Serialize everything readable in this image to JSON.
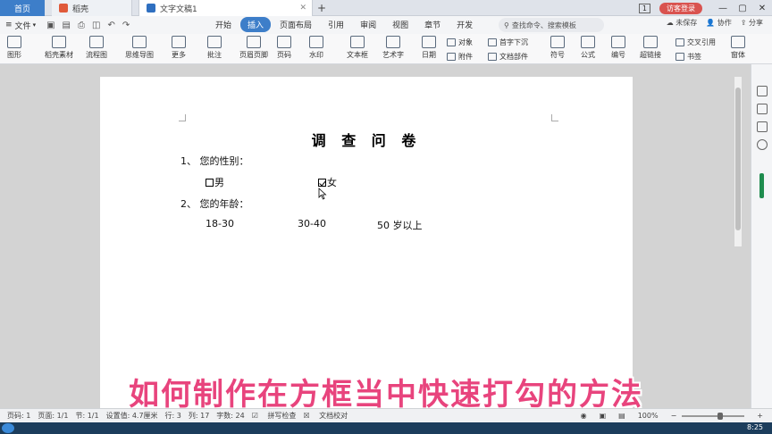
{
  "tabs": {
    "home": "首页",
    "daoke": "稻壳",
    "doc": "文字文稿1",
    "plus": "+"
  },
  "titlebar": {
    "page_badge": "1",
    "login": "访客登录",
    "min": "—",
    "max": "▢",
    "close": "✕"
  },
  "menubar": {
    "file": "文件",
    "items": [
      "开始",
      "插入",
      "页面布局",
      "引用",
      "审阅",
      "视图",
      "章节",
      "开发"
    ],
    "active_index": 1,
    "search_placeholder": "查找命令、搜索模板",
    "right": [
      "未保存",
      "协作",
      "分享"
    ]
  },
  "ribbon": {
    "large": [
      "图形",
      "稻壳素材",
      "流程图",
      "思维导图",
      "更多",
      "批注",
      "页眉页脚",
      "页码",
      "水印",
      "文本框",
      "艺术字",
      "日期",
      "符号",
      "公式",
      "编号",
      "超链接",
      "窗体"
    ],
    "small": [
      "对象",
      "附件",
      "首字下沉",
      "文档部件",
      "交叉引用",
      "书签"
    ]
  },
  "document": {
    "title": "调 查 问 卷",
    "q1": "1、 您的性别：",
    "opt_male": "男",
    "opt_female": "女",
    "q2": "2、 您的年龄：",
    "age1": "18-30",
    "age2": "30-40",
    "age3": "50 岁以上"
  },
  "overlay_caption": "如何制作在方框当中快速打勾的方法",
  "statusbar": {
    "page_num": "页码: 1",
    "pages": "页面: 1/1",
    "section": "节: 1/1",
    "setting": "设置值: 4.7厘米",
    "row": "行: 3",
    "col": "列: 17",
    "words": "字数: 24",
    "spell": "拼写检查",
    "proof": "文档校对",
    "zoom": "100%"
  },
  "taskbar": {
    "clock": "8:25"
  },
  "colors": {
    "accent": "#3d7ec9",
    "caption": "#e8447d",
    "login": "#d9534f"
  }
}
